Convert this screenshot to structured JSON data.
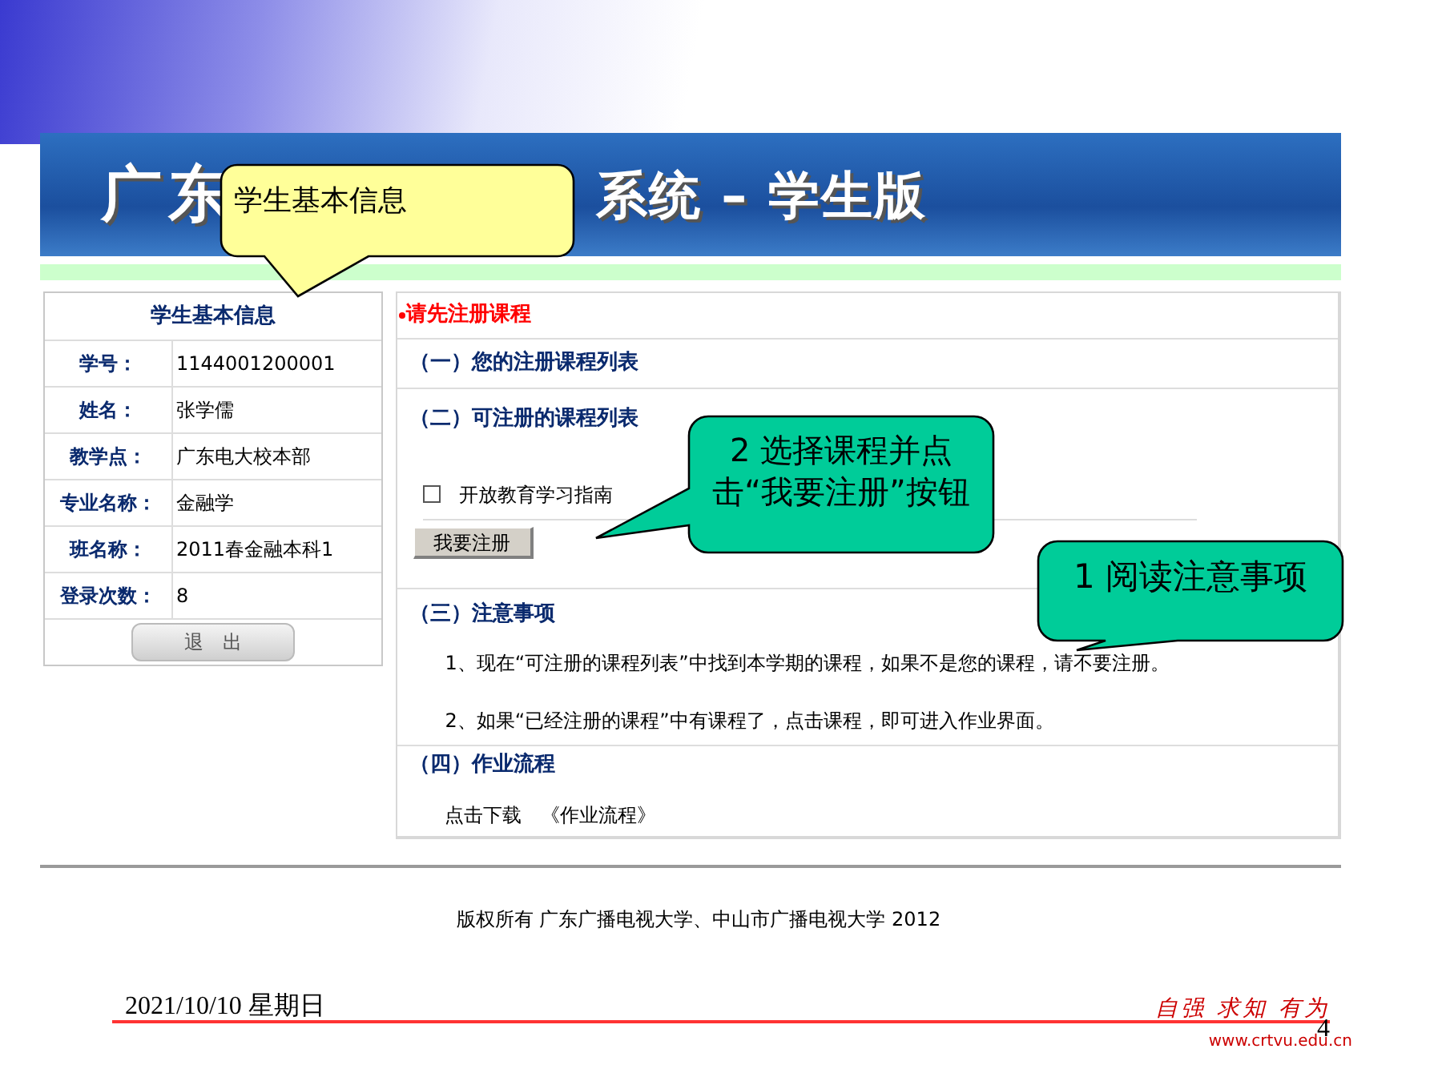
{
  "banner": {
    "title_left": "广东",
    "title_right": "系统 – 学生版"
  },
  "student_panel": {
    "title": "学生基本信息",
    "fields": [
      {
        "label": "学号：",
        "value": "1144001200001"
      },
      {
        "label": "姓名：",
        "value": "张学儒"
      },
      {
        "label": "教学点：",
        "value": "广东电大校本部"
      },
      {
        "label": "专业名称：",
        "value": "金融学"
      },
      {
        "label": "班名称：",
        "value": "2011春金融本科1"
      },
      {
        "label": "登录次数：",
        "value": "8"
      }
    ],
    "logout_button": "退　出"
  },
  "main_panel": {
    "notice": "请先注册课程",
    "sections": [
      {
        "kind": "heading",
        "heading": "（一）您的注册课程列表"
      },
      {
        "kind": "courses",
        "heading": "（二）可注册的课程列表",
        "courses": [
          {
            "name": "开放教育学习指南",
            "checked": false
          }
        ],
        "button": "我要注册"
      },
      {
        "kind": "notes",
        "heading": "（三）注意事项",
        "paragraphs": [
          "1、现在“可注册的课程列表”中找到本学期的课程，如果不是您的课程，请不要注册。",
          "2、如果“已经注册的课程”中有课程了，点击课程，即可进入作业界面。"
        ]
      },
      {
        "kind": "download",
        "heading": "（四）作业流程",
        "label": "点击下载",
        "link": "《作业流程》"
      }
    ]
  },
  "copyright": "版权所有 广东广播电视大学、中山市广播电视大学 2012",
  "callouts": [
    {
      "kind": "yellow",
      "text": "学生基本信息"
    },
    {
      "kind": "green-left",
      "text": "2 选择课程并点击“我要注册”按钮"
    },
    {
      "kind": "green-bottom",
      "text": "1 阅读注意事项"
    }
  ],
  "slide_footer": {
    "date": "2021/10/10 星期日",
    "slogan": "自强 求知 有为",
    "url": "www.crtvu.edu.cn",
    "page_number": "4"
  }
}
